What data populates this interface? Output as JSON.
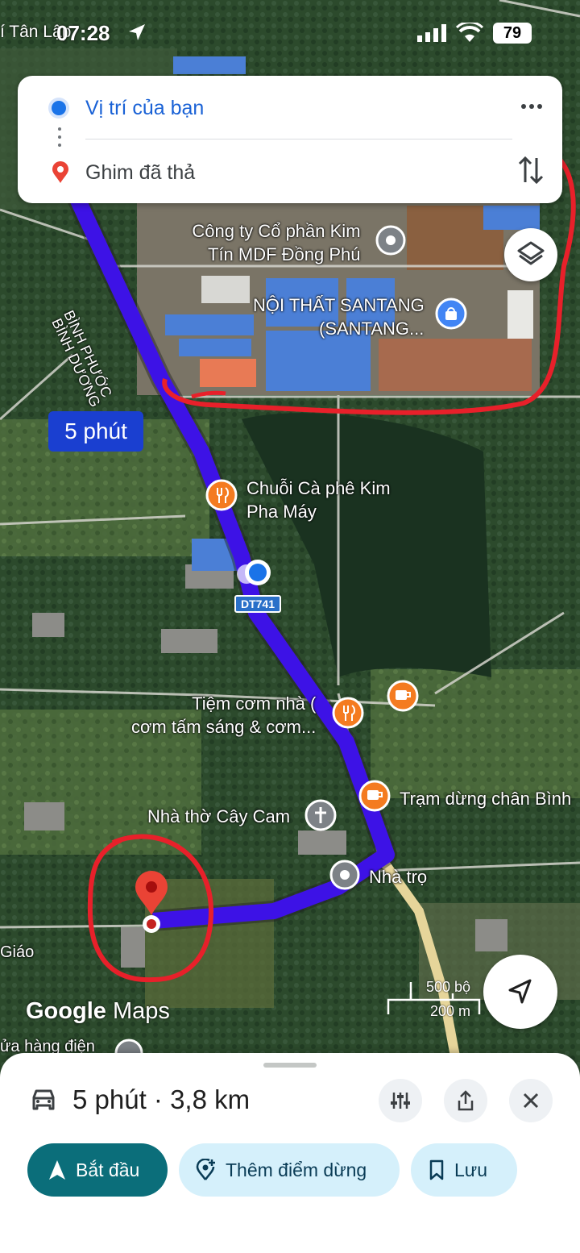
{
  "status_bar": {
    "location_fragment": "í Tân Lập",
    "time": "07:28",
    "battery": "79"
  },
  "directions": {
    "origin": "Vị trí của bạn",
    "destination": "Ghim đã thả"
  },
  "map": {
    "route_time_badge": "5 phút",
    "road_label": "DT741",
    "province_label_1": "BÌNH PHƯỚC",
    "province_label_2": "BÌNH DƯƠNG",
    "places": {
      "company_line1": "Công ty Cổ phần Kim",
      "company_line2": "Tín MDF Đồng Phú",
      "furniture_line1": "NỘI THẤT SANTANG",
      "furniture_line2": "(SANTANG...",
      "cafe_line1": "Chuỗi Cà phê Kim",
      "cafe_line2": "Pha Máy",
      "rice_line1": "Tiệm cơm nhà (",
      "rice_line2": "cơm tấm sáng & cơm...",
      "rest_stop": "Trạm dừng chân Bình",
      "church": "Nhà thờ Cây Cam",
      "motel": "Nhà trọ",
      "giao": "Giáo",
      "store": "ửa hàng điện"
    },
    "scale": {
      "imperial": "500 bộ",
      "metric": "200 m"
    },
    "brand_google": "Google",
    "brand_maps": "Maps"
  },
  "bottom_sheet": {
    "summary": "5 phút · 3,8 km",
    "start_label": "Bắt đầu",
    "add_stop_label": "Thêm điểm dừng",
    "save_label": "Lưu"
  },
  "colors": {
    "route": "#3d12e6",
    "annotation": "#e8202a",
    "start_button": "#0b6e7a",
    "chip": "#d5f0fb"
  },
  "icons": [
    "nav-arrow-icon",
    "signal-icon",
    "wifi-icon",
    "more-vert-icon",
    "swap-icon",
    "layers-icon",
    "compass-icon",
    "car-icon",
    "tune-icon",
    "share-icon",
    "close-icon",
    "navigation-icon",
    "add-location-icon",
    "bookmark-icon"
  ]
}
